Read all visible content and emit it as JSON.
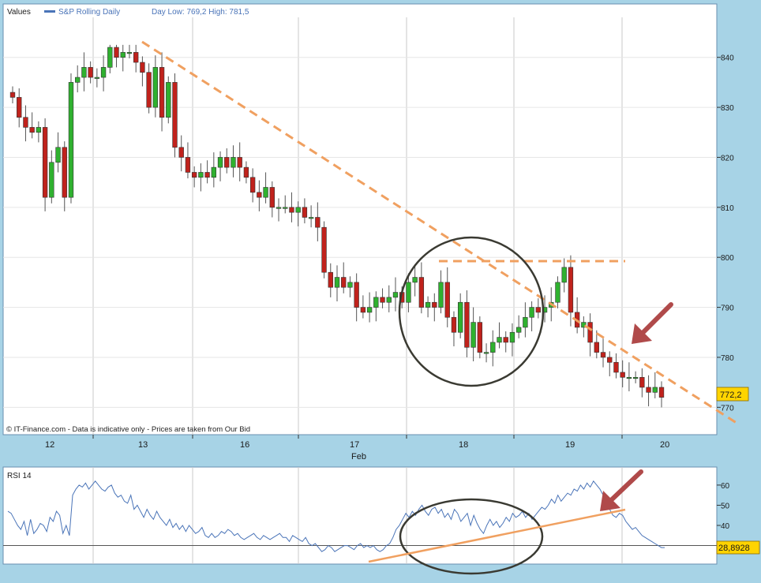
{
  "header": {
    "values_label": "Values",
    "series_label": "S&P Rolling Daily",
    "day_low_high": "Day Low: 769,2 High: 781,5"
  },
  "footer_note": "© IT-Finance.com - Data is indicative only - Prices are taken from Our Bid",
  "colors": {
    "up": "#2fb12f",
    "down": "#c0221c",
    "trendline": "#f0a060",
    "rsi_line": "#4a74b8",
    "annotation_arrow": "#b04a4a",
    "circle": "#3a3a32",
    "last_price_bg": "#ffd400"
  },
  "chart_data": [
    {
      "type": "candlestick",
      "name": "S&P Rolling Daily",
      "ylim": [
        765,
        848
      ],
      "y_ticks": [
        770,
        780,
        790,
        800,
        810,
        820,
        830,
        840
      ],
      "x_tick_labels": [
        "12",
        "13",
        "16",
        "17",
        "18",
        "19",
        "20"
      ],
      "x_month_label": "Feb",
      "last_price": "772,2",
      "grid": true,
      "closes": [
        832,
        828,
        826,
        825,
        826,
        812,
        819,
        822,
        812,
        835,
        836,
        838,
        836,
        836,
        838,
        842,
        840,
        841,
        841,
        839,
        837,
        830,
        838,
        828,
        835,
        822,
        820,
        817,
        816,
        817,
        816,
        818,
        820,
        818,
        820,
        818,
        816,
        813,
        812,
        814,
        810,
        810,
        810,
        809,
        810,
        808,
        808,
        806,
        797,
        794,
        796,
        794,
        795,
        790,
        789,
        790,
        792,
        791,
        792,
        793,
        791,
        795,
        796,
        790,
        791,
        790,
        795,
        788,
        785,
        791,
        782,
        787,
        781,
        781,
        783,
        784,
        783,
        785,
        786,
        788,
        790,
        789,
        790,
        791,
        795,
        798,
        789,
        786,
        787,
        783,
        781,
        780,
        779,
        777,
        776,
        776,
        776,
        774,
        773,
        774,
        772
      ],
      "hl_min": 768.8,
      "hl_max": 842.5
    },
    {
      "type": "line",
      "name": "RSI 14",
      "ylim": [
        22,
        67
      ],
      "y_ticks": [
        40,
        50,
        60
      ],
      "reference_level": 30,
      "last_value": "28,8928",
      "values": [
        47,
        46,
        43,
        40,
        38,
        42,
        35,
        43,
        36,
        38,
        41,
        40,
        37,
        44,
        42,
        47,
        45,
        36,
        40,
        35,
        55,
        58,
        60,
        59,
        61,
        58,
        60,
        62,
        60,
        58,
        57,
        59,
        60,
        56,
        54,
        55,
        52,
        51,
        55,
        48,
        50,
        47,
        44,
        48,
        45,
        43,
        47,
        44,
        42,
        40,
        43,
        39,
        41,
        38,
        40,
        37,
        40,
        38,
        36,
        37,
        39,
        35,
        34,
        36,
        34,
        35,
        37,
        36,
        38,
        37,
        35,
        36,
        34,
        33,
        34,
        35,
        36,
        34,
        33,
        35,
        34,
        33,
        34,
        35,
        36,
        34,
        34,
        32,
        35,
        34,
        33,
        32,
        34,
        31,
        30,
        31,
        29,
        27,
        28,
        30,
        29,
        27,
        28,
        29,
        30,
        30,
        29,
        28,
        30,
        31,
        29,
        30,
        29,
        30,
        28,
        27,
        28,
        30,
        31,
        34,
        38,
        40,
        43,
        46,
        44,
        47,
        45,
        48,
        50,
        47,
        45,
        48,
        49,
        46,
        48,
        44,
        46,
        43,
        48,
        46,
        42,
        44,
        46,
        40,
        45,
        41,
        38,
        36,
        40,
        43,
        40,
        42,
        39,
        41,
        44,
        42,
        46,
        44,
        45,
        47,
        44,
        46,
        43,
        45,
        47,
        49,
        48,
        50,
        53,
        51,
        55,
        52,
        54,
        56,
        55,
        58,
        57,
        60,
        58,
        61,
        59,
        62,
        60,
        58,
        55,
        52,
        48,
        45,
        44,
        46,
        45,
        42,
        40,
        38,
        39,
        37,
        35,
        34,
        33,
        32,
        31,
        30,
        29,
        29
      ]
    }
  ]
}
